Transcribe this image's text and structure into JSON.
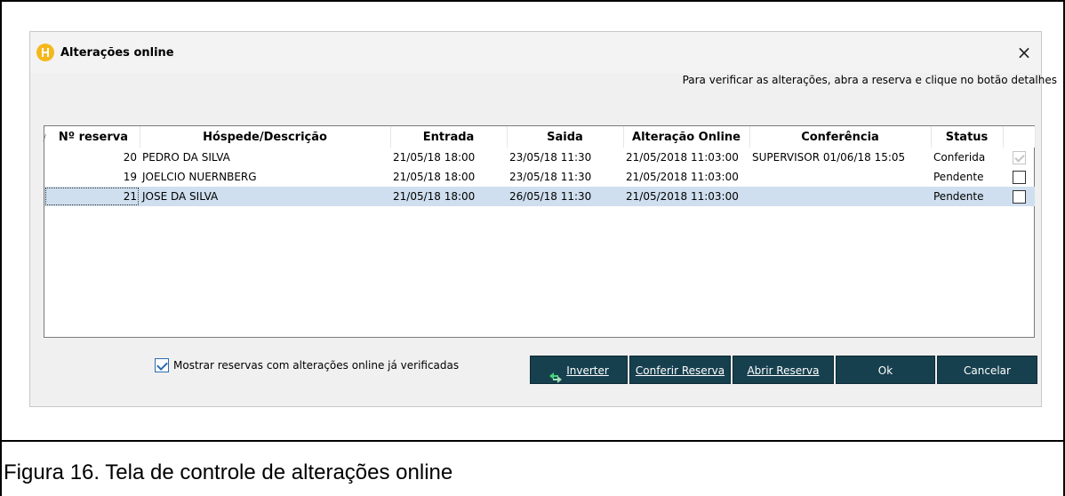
{
  "dialog": {
    "title": "Alterações online",
    "close_glyph": "×",
    "hint": "Para verificar as alterações, abra a reserva e clique no botão detalhes",
    "app_icon": "hotel-h-icon"
  },
  "table": {
    "sort_glyph": "/",
    "columns": [
      "Nº reserva",
      "Hóspede/Descrição",
      "Entrada",
      "Saida",
      "Alteração Online",
      "Conferência",
      "Status"
    ],
    "rows": [
      {
        "reserva": "20",
        "hospede": "PEDRO DA SILVA",
        "entrada": "21/05/18 18:00",
        "saida": "23/05/18 11:30",
        "alteracao": "21/05/2018 11:03:00",
        "conferencia": "SUPERVISOR 01/06/18 15:05",
        "status": "Conferida",
        "checked": true
      },
      {
        "reserva": "19",
        "hospede": "JOELCIO NUERNBERG",
        "entrada": "21/05/18 18:00",
        "saida": "23/05/18 11:30",
        "alteracao": "21/05/2018 11:03:00",
        "conferencia": "",
        "status": "Pendente",
        "checked": false
      },
      {
        "reserva": "21",
        "hospede": "JOSE DA SILVA",
        "entrada": "21/05/18 18:00",
        "saida": "26/05/18 11:30",
        "alteracao": "21/05/2018 11:03:00",
        "conferencia": "",
        "status": "Pendente",
        "checked": false
      }
    ],
    "selected_row": 2
  },
  "footer": {
    "show_verified_label": "Mostrar reservas com alterações online já verificadas",
    "show_verified_checked": true,
    "buttons": {
      "inverter": "Inverter",
      "conferir": "Conferir Reserva",
      "abrir": "Abrir Reserva",
      "ok": "Ok",
      "cancelar": "Cancelar"
    }
  },
  "caption": "Figura 16. Tela de controle de alterações online",
  "colors": {
    "button_bg": "#17404f",
    "selected_row": "#cfdfef",
    "app_icon": "#f5b81c"
  }
}
